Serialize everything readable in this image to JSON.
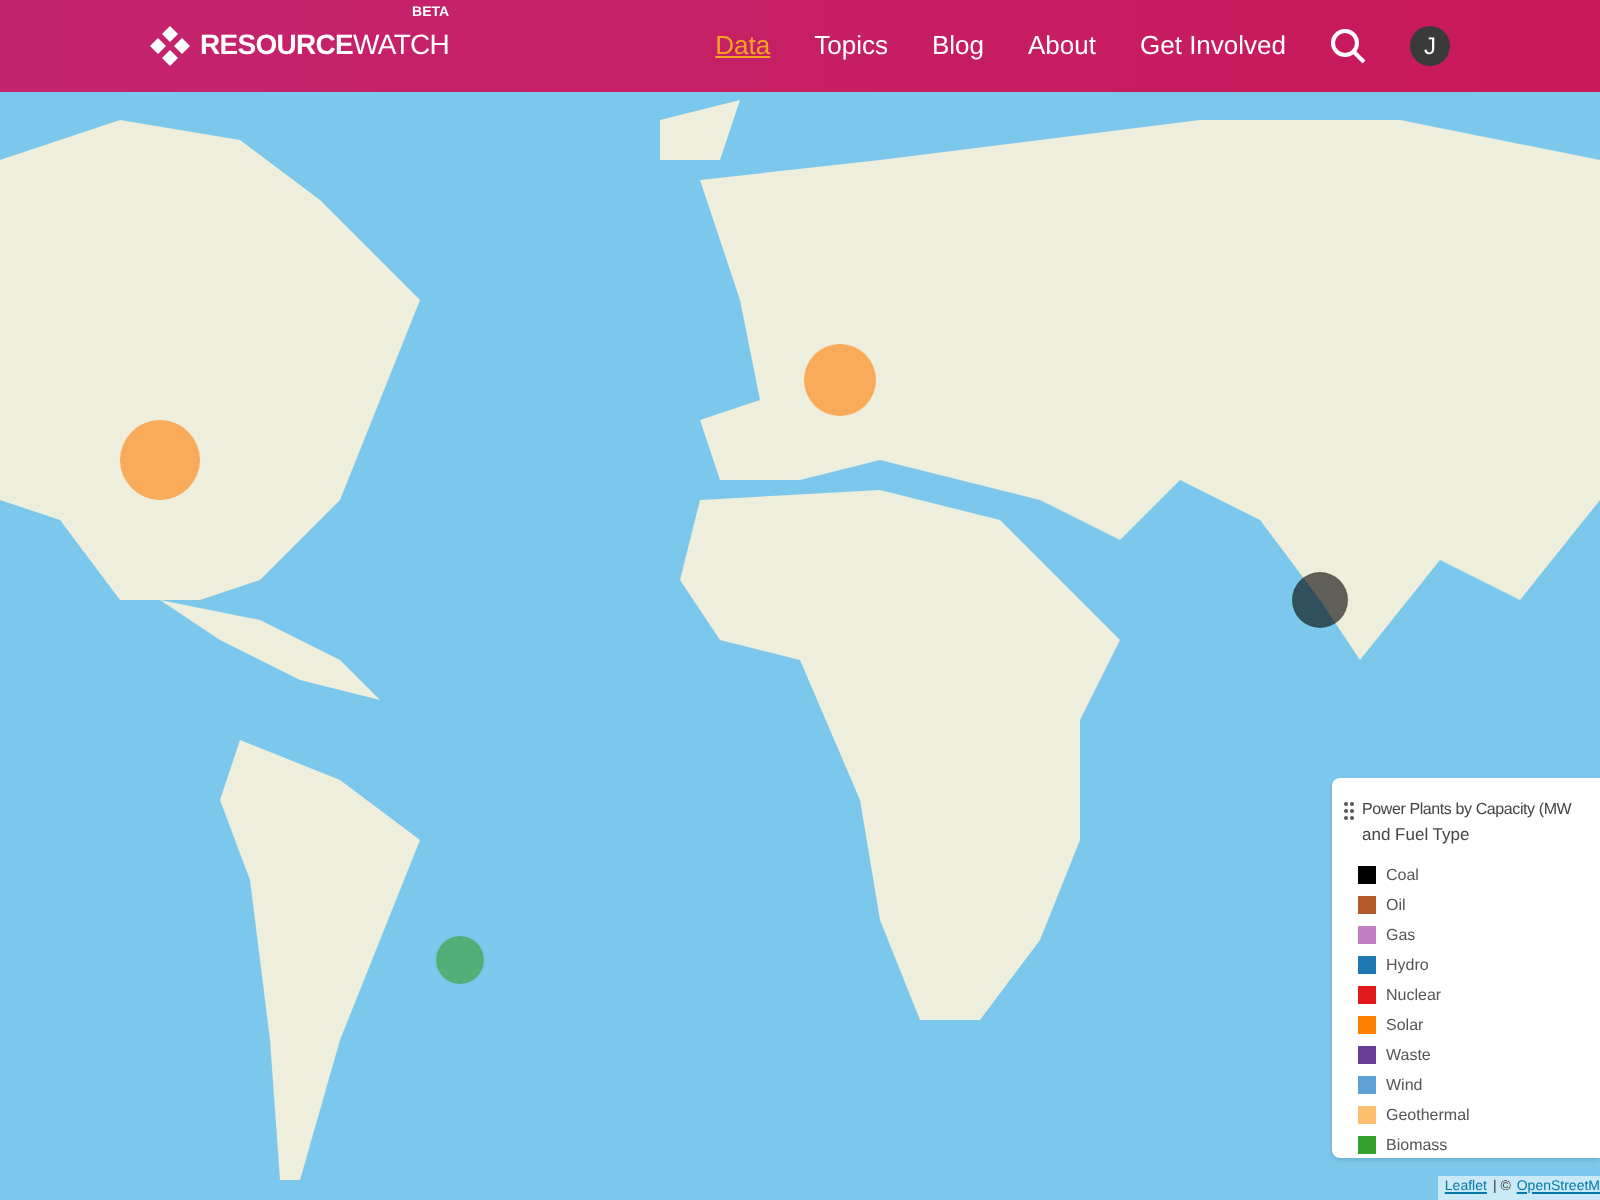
{
  "header": {
    "logo": {
      "name": "RESOURCE",
      "suffix": "WATCH",
      "badge": "BETA"
    },
    "nav": [
      {
        "label": "Data",
        "selected": true
      },
      {
        "label": "Topics",
        "selected": false
      },
      {
        "label": "Blog",
        "selected": false
      },
      {
        "label": "About",
        "selected": false
      },
      {
        "label": "Get Involved",
        "selected": false
      }
    ],
    "avatar": "J"
  },
  "legend": {
    "title": "Power Plants by Capacity (MW",
    "subtitle": "and Fuel Type",
    "items": [
      {
        "label": "Coal",
        "color": "#000000"
      },
      {
        "label": "Oil",
        "color": "#b15928"
      },
      {
        "label": "Gas",
        "color": "#c27fc2"
      },
      {
        "label": "Hydro",
        "color": "#1f78b4"
      },
      {
        "label": "Nuclear",
        "color": "#e31a1c"
      },
      {
        "label": "Solar",
        "color": "#ff7f00"
      },
      {
        "label": "Waste",
        "color": "#6a3d9a"
      },
      {
        "label": "Wind",
        "color": "#5ea1d6"
      },
      {
        "label": "Geothermal",
        "color": "#fdbf6f"
      },
      {
        "label": "Biomass",
        "color": "#33a02c"
      }
    ]
  },
  "attribution": {
    "link": "Leaflet",
    "separator": "| ©",
    "source": "OpenStreetM"
  }
}
